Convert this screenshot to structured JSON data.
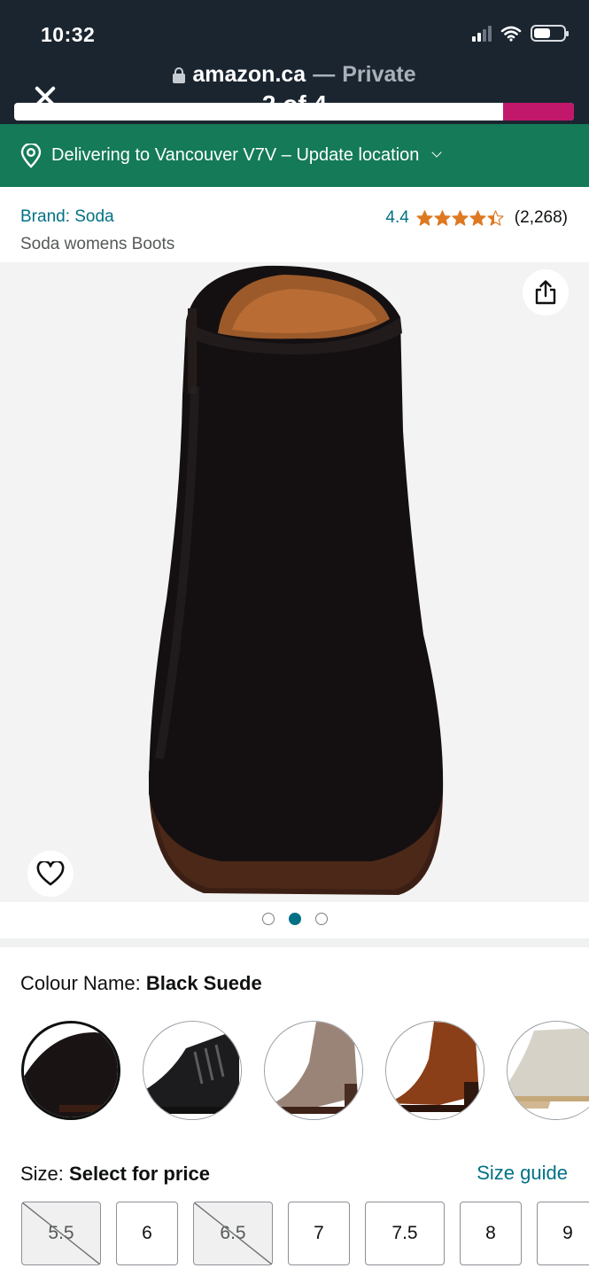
{
  "browser": {
    "time": "10:32",
    "host": "amazon.ca",
    "separator": "—",
    "private_label": "Private",
    "page_counter": "2 of 4"
  },
  "location": {
    "text": "Delivering to Vancouver V7V – Update location"
  },
  "product": {
    "brand": "Brand: Soda",
    "title": "Soda womens Boots",
    "rating_value": "4.4",
    "rating_stars": 4.4,
    "rating_count": "(2,268)",
    "image_index": 2,
    "image_total": 3
  },
  "colour": {
    "label": "Colour Name: ",
    "value": "Black Suede",
    "swatches": [
      "black-suede",
      "black-leather",
      "taupe",
      "cognac",
      "beige"
    ]
  },
  "size": {
    "label": "Size: ",
    "value": "Select for price",
    "guide_label": "Size guide",
    "options": [
      {
        "label": "5.5",
        "available": false
      },
      {
        "label": "6",
        "available": true
      },
      {
        "label": "6.5",
        "available": false
      },
      {
        "label": "7",
        "available": true
      },
      {
        "label": "7.5",
        "available": true
      },
      {
        "label": "8",
        "available": true
      },
      {
        "label": "9",
        "available": true
      }
    ]
  },
  "colors": {
    "chrome_bg": "#1b2530",
    "location_bg": "#147a57",
    "link": "#007185",
    "star": "#de7921",
    "dot_active": "#007185"
  }
}
